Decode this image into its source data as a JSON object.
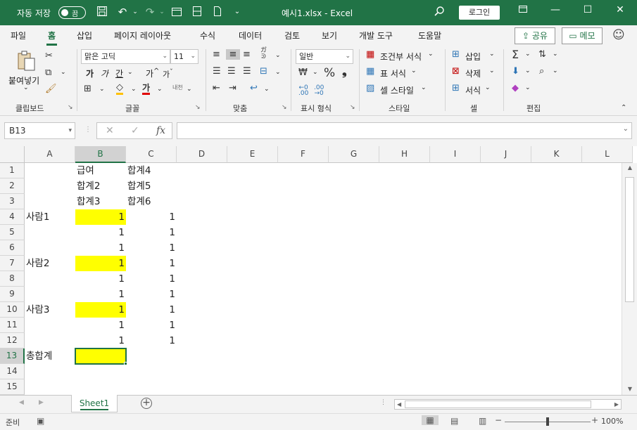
{
  "titlebar": {
    "autosave_label": "자동 저장",
    "autosave_state": "끔",
    "title": "예시1.xlsx  -  Excel",
    "login": "로그인"
  },
  "menu": {
    "tabs": [
      "파일",
      "홈",
      "삽입",
      "페이지 레이아웃",
      "수식",
      "데이터",
      "검토",
      "보기",
      "개발 도구",
      "도움말"
    ],
    "active_tab": "홈",
    "share": "공유",
    "memo": "메모"
  },
  "ribbon": {
    "clipboard": {
      "paste": "붙여넣기",
      "label": "클립보드"
    },
    "font": {
      "name": "맑은 고딕",
      "size": "11",
      "label": "글꼴",
      "bold": "가",
      "italic": "가",
      "underline": "간",
      "grow": "가",
      "shrink": "가"
    },
    "alignment": {
      "label": "맞춤"
    },
    "number": {
      "format": "일반",
      "label": "표시 형식"
    },
    "styles": {
      "conditional": "조건부 서식",
      "table": "표 서식",
      "cell": "셀 스타일",
      "label": "스타일"
    },
    "cells": {
      "insert": "삽입",
      "delete": "삭제",
      "format": "서식",
      "label": "셀"
    },
    "editing": {
      "label": "편집"
    }
  },
  "formula_bar": {
    "name_box": "B13",
    "fx": "fx",
    "value": ""
  },
  "grid": {
    "columns": [
      "A",
      "B",
      "C",
      "D",
      "E",
      "F",
      "G",
      "H",
      "I",
      "J",
      "K",
      "L"
    ],
    "rows": [
      "1",
      "2",
      "3",
      "4",
      "5",
      "6",
      "7",
      "8",
      "9",
      "10",
      "11",
      "12",
      "13",
      "14",
      "15"
    ],
    "cells": [
      {
        "ref": "B1",
        "value": "급여"
      },
      {
        "ref": "C1",
        "value": "합계4"
      },
      {
        "ref": "B2",
        "value": "합계2"
      },
      {
        "ref": "C2",
        "value": "합계5"
      },
      {
        "ref": "B3",
        "value": "합계3"
      },
      {
        "ref": "C3",
        "value": "합계6"
      },
      {
        "ref": "A4",
        "value": "사람1"
      },
      {
        "ref": "B4",
        "value": "1"
      },
      {
        "ref": "C4",
        "value": "1"
      },
      {
        "ref": "B5",
        "value": "1"
      },
      {
        "ref": "C5",
        "value": "1"
      },
      {
        "ref": "B6",
        "value": "1"
      },
      {
        "ref": "C6",
        "value": "1"
      },
      {
        "ref": "A7",
        "value": "사람2"
      },
      {
        "ref": "B7",
        "value": "1"
      },
      {
        "ref": "C7",
        "value": "1"
      },
      {
        "ref": "B8",
        "value": "1"
      },
      {
        "ref": "C8",
        "value": "1"
      },
      {
        "ref": "B9",
        "value": "1"
      },
      {
        "ref": "C9",
        "value": "1"
      },
      {
        "ref": "A10",
        "value": "사람3"
      },
      {
        "ref": "B10",
        "value": "1"
      },
      {
        "ref": "C10",
        "value": "1"
      },
      {
        "ref": "B11",
        "value": "1"
      },
      {
        "ref": "C11",
        "value": "1"
      },
      {
        "ref": "B12",
        "value": "1"
      },
      {
        "ref": "C12",
        "value": "1"
      },
      {
        "ref": "A13",
        "value": "총합계"
      },
      {
        "ref": "B13",
        "value": ""
      }
    ],
    "highlight_color": "#ffff00",
    "highlighted_cells": [
      "B4",
      "B7",
      "B10",
      "B13"
    ],
    "active_cell": "B13",
    "selected_column": "B",
    "selected_row": "13"
  },
  "sheets": {
    "tabs": [
      "Sheet1"
    ],
    "active": "Sheet1"
  },
  "status": {
    "ready": "준비",
    "zoom": "100%"
  },
  "colors": {
    "accent": "#217346"
  }
}
